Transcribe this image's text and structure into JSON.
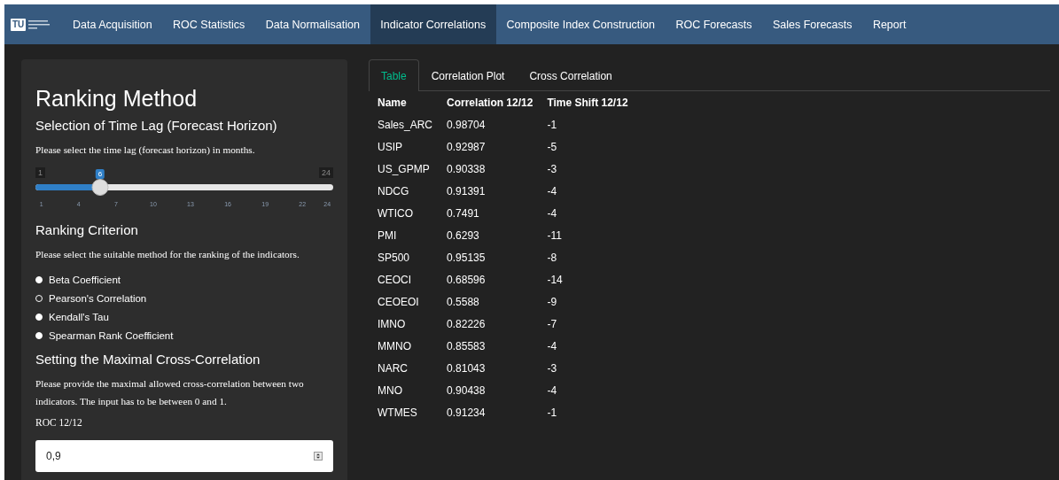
{
  "navbar": {
    "logo": {
      "mark": "TU"
    },
    "items": [
      {
        "label": "Data Acquisition",
        "selected": false
      },
      {
        "label": "ROC Statistics",
        "selected": false
      },
      {
        "label": "Data Normalisation",
        "selected": false
      },
      {
        "label": "Indicator Correlations",
        "selected": true
      },
      {
        "label": "Composite Index Construction",
        "selected": false
      },
      {
        "label": "ROC Forecasts",
        "selected": false
      },
      {
        "label": "Sales Forecasts",
        "selected": false
      },
      {
        "label": "Report",
        "selected": false
      }
    ]
  },
  "sidebar": {
    "title": "Ranking Method",
    "lag": {
      "heading": "Selection of Time Lag (Forecast Horizon)",
      "help": "Please select the time lag (forecast horizon) in months.",
      "slider": {
        "min_label": "1",
        "max_label": "24",
        "value": "6",
        "level": 0.217,
        "ticks": [
          "1",
          "4",
          "7",
          "10",
          "13",
          "16",
          "19",
          "22",
          "24"
        ]
      }
    },
    "criterion": {
      "heading": "Ranking Criterion",
      "help": "Please select the suitable method for the ranking of the indicators.",
      "options": [
        {
          "label": "Beta Coefficient",
          "selected": false
        },
        {
          "label": "Pearson's Correlation",
          "selected": true
        },
        {
          "label": "Kendall's Tau",
          "selected": false
        },
        {
          "label": "Spearman Rank Coefficient",
          "selected": false
        }
      ]
    },
    "cross": {
      "heading": "Setting the Maximal Cross-Correlation",
      "help": "Please provide the maximal allowed cross-correlation between two indicators. The input has to be between 0 and 1.",
      "label": "ROC 12/12",
      "value": "0,9"
    }
  },
  "main": {
    "tabs": [
      {
        "label": "Table",
        "selected": true
      },
      {
        "label": "Correlation Plot",
        "selected": false
      },
      {
        "label": "Cross Correlation",
        "selected": false
      }
    ],
    "table": {
      "columns": [
        "Name",
        "Correlation 12/12",
        "Time Shift 12/12"
      ],
      "rows": [
        [
          "Sales_ARC",
          "0.98704",
          "-1"
        ],
        [
          "USIP",
          "0.92987",
          "-5"
        ],
        [
          "US_GPMP",
          "0.90338",
          "-3"
        ],
        [
          "NDCG",
          "0.91391",
          "-4"
        ],
        [
          "WTICO",
          "0.7491",
          "-4"
        ],
        [
          "PMI",
          "0.6293",
          "-11"
        ],
        [
          "SP500",
          "0.95135",
          "-8"
        ],
        [
          "CEOCI",
          "0.68596",
          "-14"
        ],
        [
          "CEOEOI",
          "0.5588",
          "-9"
        ],
        [
          "IMNO",
          "0.82226",
          "-7"
        ],
        [
          "MMNO",
          "0.85583",
          "-4"
        ],
        [
          "NARC",
          "0.81043",
          "-3"
        ],
        [
          "MNO",
          "0.90438",
          "-4"
        ],
        [
          "WTMES",
          "0.91234",
          "-1"
        ]
      ]
    }
  }
}
